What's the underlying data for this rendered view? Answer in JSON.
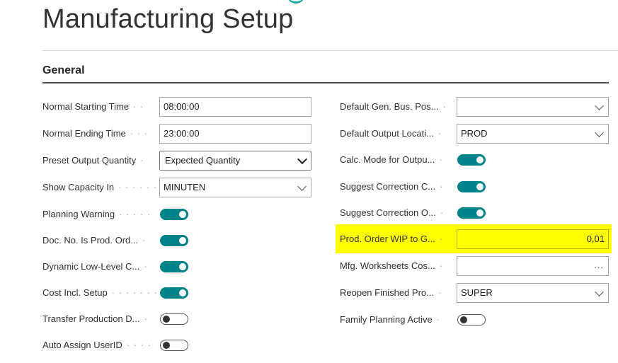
{
  "page": {
    "title": "Manufacturing Setup",
    "section": "General"
  },
  "left": {
    "normal_starting_time": {
      "label": "Normal Starting Time",
      "value": "08:00:00"
    },
    "normal_ending_time": {
      "label": "Normal Ending Time",
      "value": "23:00:00"
    },
    "preset_output_quantity": {
      "label": "Preset Output Quantity",
      "value": "Expected Quantity"
    },
    "show_capacity_in": {
      "label": "Show Capacity In",
      "value": "MINUTEN"
    },
    "planning_warning": {
      "label": "Planning Warning",
      "on": true
    },
    "doc_no_is_prod_order": {
      "label": "Doc. No. Is Prod. Ord...",
      "on": true
    },
    "dynamic_low_level": {
      "label": "Dynamic Low-Level C...",
      "on": true
    },
    "cost_incl_setup": {
      "label": "Cost Incl. Setup",
      "on": true
    },
    "transfer_production": {
      "label": "Transfer Production D...",
      "on": false
    },
    "auto_assign_userid": {
      "label": "Auto Assign UserID",
      "on": false
    }
  },
  "right": {
    "default_gen_bus_pos": {
      "label": "Default Gen. Bus. Pos...",
      "value": ""
    },
    "default_output_location": {
      "label": "Default Output Locati...",
      "value": "PROD"
    },
    "calc_mode_output": {
      "label": "Calc. Mode for Outpu...",
      "on": true
    },
    "suggest_correction_c": {
      "label": "Suggest Correction C...",
      "on": true
    },
    "suggest_correction_o": {
      "label": "Suggest Correction O...",
      "on": true
    },
    "prod_order_wip": {
      "label": "Prod. Order WIP to G...",
      "value": "0,01"
    },
    "mfg_worksheets_cost": {
      "label": "Mfg. Worksheets Cos...",
      "value": "",
      "ellipsis": "..."
    },
    "reopen_finished_prod": {
      "label": "Reopen Finished Pro...",
      "value": "SUPER"
    },
    "family_planning_active": {
      "label": "Family Planning Active",
      "on": false
    }
  },
  "colors": {
    "accent": "#008489",
    "highlight": "#ffff00"
  }
}
